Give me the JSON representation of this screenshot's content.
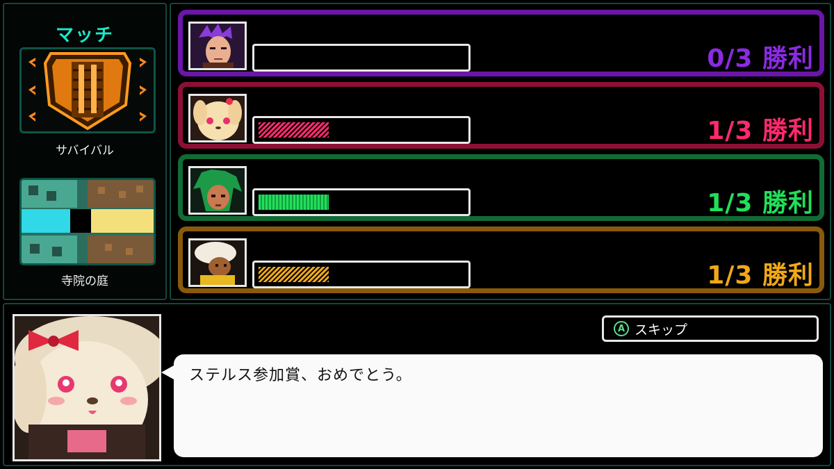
{
  "match": {
    "title": "マッチ",
    "mode_label": "サバイバル",
    "mode_icon": "shield-icon",
    "map_label": "寺院の庭"
  },
  "players": [
    {
      "wins_text": "0/3 勝利",
      "progress": 0.0,
      "color": "#8a2be2",
      "border": "#6a16a8",
      "pattern": "none"
    },
    {
      "wins_text": "1/3 勝利",
      "progress": 0.34,
      "color": "#ff2a6d",
      "border": "#8c1036",
      "pattern": "stripes"
    },
    {
      "wins_text": "1/3 勝利",
      "progress": 0.34,
      "color": "#1fe05a",
      "border": "#126b34",
      "pattern": "checks"
    },
    {
      "wins_text": "1/3 勝利",
      "progress": 0.34,
      "color": "#f0a818",
      "border": "#8a5a0c",
      "pattern": "stripes"
    }
  ],
  "dialog": {
    "text": "ステルス参加賞、おめでとう。",
    "skip_label": "スキップ",
    "skip_icon": "a-button-icon"
  }
}
